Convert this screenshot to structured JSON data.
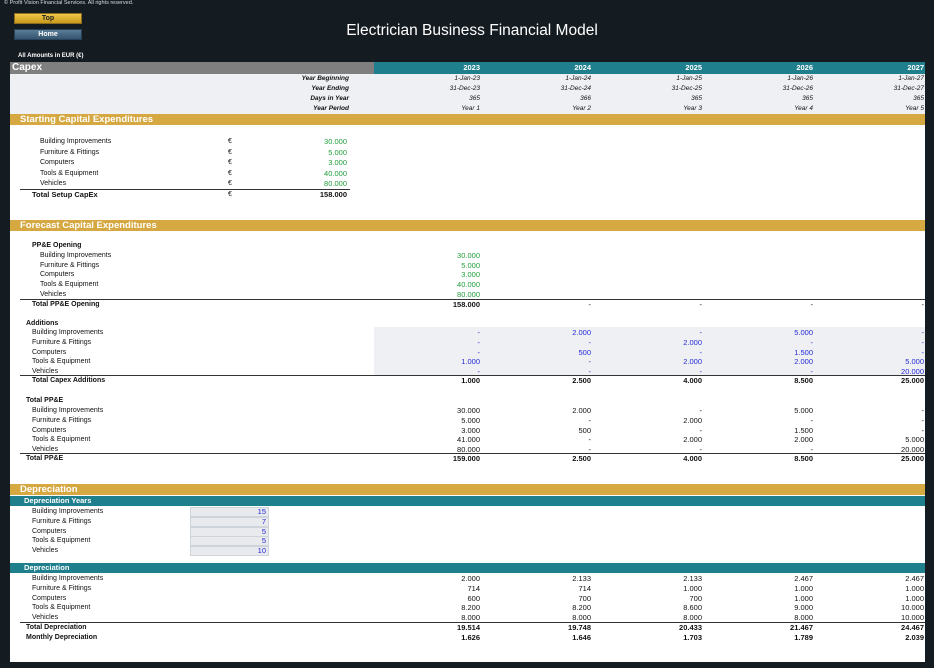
{
  "header": {
    "copyright": "© Profit Vision Financial Services. All rights reserved.",
    "top_label": "Top",
    "home_label": "Home",
    "title": "Electrician Business Financial Model",
    "amounts_note": "All Amounts in  EUR (€)"
  },
  "capex_title": "Capex",
  "years": [
    "2023",
    "2024",
    "2025",
    "2026",
    "2027"
  ],
  "timeline": [
    {
      "label": "Year Beginning",
      "values": [
        "1-Jan-23",
        "1-Jan-24",
        "1-Jan-25",
        "1-Jan-26",
        "1-Jan-27"
      ]
    },
    {
      "label": "Year Ending",
      "values": [
        "31-Dec-23",
        "31-Dec-24",
        "31-Dec-25",
        "31-Dec-26",
        "31-Dec-27"
      ]
    },
    {
      "label": "Days in Year",
      "values": [
        "365",
        "366",
        "365",
        "365",
        "365"
      ]
    },
    {
      "label": "Year Period",
      "values": [
        "Year 1",
        "Year 2",
        "Year 3",
        "Year 4",
        "Year 5"
      ]
    }
  ],
  "starting": {
    "title": "Starting Capital Expenditures",
    "currency": "€",
    "items": [
      {
        "label": "Building Improvements",
        "value": "30.000"
      },
      {
        "label": "Furniture & Fittings",
        "value": "5.000"
      },
      {
        "label": "Computers",
        "value": "3.000"
      },
      {
        "label": "Tools & Equipment",
        "value": "40.000"
      },
      {
        "label": "Vehicles",
        "value": "80.000"
      }
    ],
    "total_label": "Total Setup CapEx",
    "total_value": "158.000"
  },
  "forecast": {
    "title": "Forecast Capital Expenditures",
    "opening": {
      "title": "PP&E Opening",
      "items": [
        {
          "label": "Building Improvements",
          "value": "30.000"
        },
        {
          "label": "Furniture & Fittings",
          "value": "5.000"
        },
        {
          "label": "Computers",
          "value": "3.000"
        },
        {
          "label": "Tools & Equipment",
          "value": "40.000"
        },
        {
          "label": "Vehicles",
          "value": "80.000"
        }
      ],
      "total_label": "Total PP&E Opening",
      "total_values": [
        "158.000",
        "-",
        "-",
        "-",
        "-"
      ]
    },
    "additions": {
      "title": "Additions",
      "items": [
        {
          "label": "Building Improvements",
          "values": [
            "-",
            "2.000",
            "-",
            "5.000",
            "-"
          ]
        },
        {
          "label": "Furniture & Fittings",
          "values": [
            "-",
            "-",
            "2.000",
            "-",
            "-"
          ]
        },
        {
          "label": "Computers",
          "values": [
            "-",
            "500",
            "-",
            "1.500",
            "-"
          ]
        },
        {
          "label": "Tools & Equipment",
          "values": [
            "1.000",
            "-",
            "2.000",
            "2.000",
            "5.000"
          ]
        },
        {
          "label": "Vehicles",
          "values": [
            "-",
            "-",
            "-",
            "-",
            "20.000"
          ]
        }
      ],
      "total_label": "Total Capex Additions",
      "total_values": [
        "1.000",
        "2.500",
        "4.000",
        "8.500",
        "25.000"
      ]
    },
    "total_ppe": {
      "title": "Total PP&E",
      "items": [
        {
          "label": "Building Improvements",
          "values": [
            "30.000",
            "2.000",
            "-",
            "5.000",
            "-"
          ]
        },
        {
          "label": "Furniture & Fittings",
          "values": [
            "5.000",
            "-",
            "2.000",
            "-",
            "-"
          ]
        },
        {
          "label": "Computers",
          "values": [
            "3.000",
            "500",
            "-",
            "1.500",
            "-"
          ]
        },
        {
          "label": "Tools & Equipment",
          "values": [
            "41.000",
            "-",
            "2.000",
            "2.000",
            "5.000"
          ]
        },
        {
          "label": "Vehicles",
          "values": [
            "80.000",
            "-",
            "-",
            "-",
            "20.000"
          ]
        }
      ],
      "total_label": "Total PP&E",
      "total_values": [
        "159.000",
        "2.500",
        "4.000",
        "8.500",
        "25.000"
      ]
    }
  },
  "depreciation": {
    "title": "Depreciation",
    "years_title": "Depreciation Years",
    "years_items": [
      {
        "label": "Building Improvements",
        "value": "15"
      },
      {
        "label": "Furniture & Fittings",
        "value": "7"
      },
      {
        "label": "Computers",
        "value": "5"
      },
      {
        "label": "Tools & Equipment",
        "value": "5"
      },
      {
        "label": "Vehicles",
        "value": "10"
      }
    ],
    "schedule_title": "Depreciation",
    "items": [
      {
        "label": "Building Improvements",
        "values": [
          "2.000",
          "2.133",
          "2.133",
          "2.467",
          "2.467"
        ]
      },
      {
        "label": "Furniture & Fittings",
        "values": [
          "714",
          "714",
          "1.000",
          "1.000",
          "1.000"
        ]
      },
      {
        "label": "Computers",
        "values": [
          "600",
          "700",
          "700",
          "1.000",
          "1.000"
        ]
      },
      {
        "label": "Tools & Equipment",
        "values": [
          "8.200",
          "8.200",
          "8.600",
          "9.000",
          "10.000"
        ]
      },
      {
        "label": "Vehicles",
        "values": [
          "8.000",
          "8.000",
          "8.000",
          "8.000",
          "10.000"
        ]
      }
    ],
    "total_label": "Total Depreciation",
    "total_values": [
      "19.514",
      "19.748",
      "20.433",
      "21.467",
      "24.467"
    ],
    "monthly_label": "Monthly Depreciation",
    "monthly_values": [
      "1.626",
      "1.646",
      "1.703",
      "1.789",
      "2.039"
    ]
  }
}
